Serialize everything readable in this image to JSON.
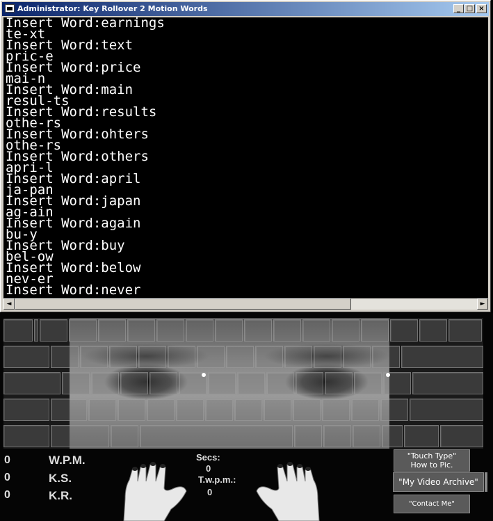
{
  "window": {
    "title": "Administrator:  Key Rollover 2 Motion Words",
    "minimize": "_",
    "maximize": "□",
    "close": "×"
  },
  "console": {
    "lines": [
      "Insert Word:earnings",
      "te-xt",
      "Insert Word:text",
      "pric-e",
      "Insert Word:price",
      "mai-n",
      "Insert Word:main",
      "resul-ts",
      "Insert Word:results",
      "othe-rs",
      "Insert Word:ohters",
      "othe-rs",
      "Insert Word:others",
      "apri-l",
      "Insert Word:april",
      "ja-pan",
      "Insert Word:japan",
      "ag-ain",
      "Insert Word:again",
      "bu-y",
      "Insert Word:buy",
      "bel-ow",
      "Insert Word:below",
      "nev-er",
      "Insert Word:never"
    ]
  },
  "scrollbar": {
    "left": "◄",
    "right": "►"
  },
  "stats": {
    "wpm": {
      "value": "0",
      "label": "W.P.M."
    },
    "ks": {
      "value": "0",
      "label": "K.S."
    },
    "kr": {
      "value": "0",
      "label": "K.R."
    }
  },
  "center": {
    "secs_label": "Secs:",
    "secs_value": "0",
    "twpm_label": "T.w.p.m.:",
    "twpm_value": "0"
  },
  "buttons": {
    "touch_line1": "\"Touch Type\"",
    "touch_line2": "How to Pic.",
    "video": "\"My Video Archive\"",
    "contact": "\"Contact Me\""
  },
  "icons": {
    "window_icon": "console-window-icon",
    "hands": "hands-on-keyboard-icon"
  },
  "colors": {
    "titlebar_start": "#0a246a",
    "titlebar_end": "#a6caf0",
    "console_bg": "#000000",
    "console_text": "#ffffff",
    "button_bg": "#5a5a5a"
  }
}
